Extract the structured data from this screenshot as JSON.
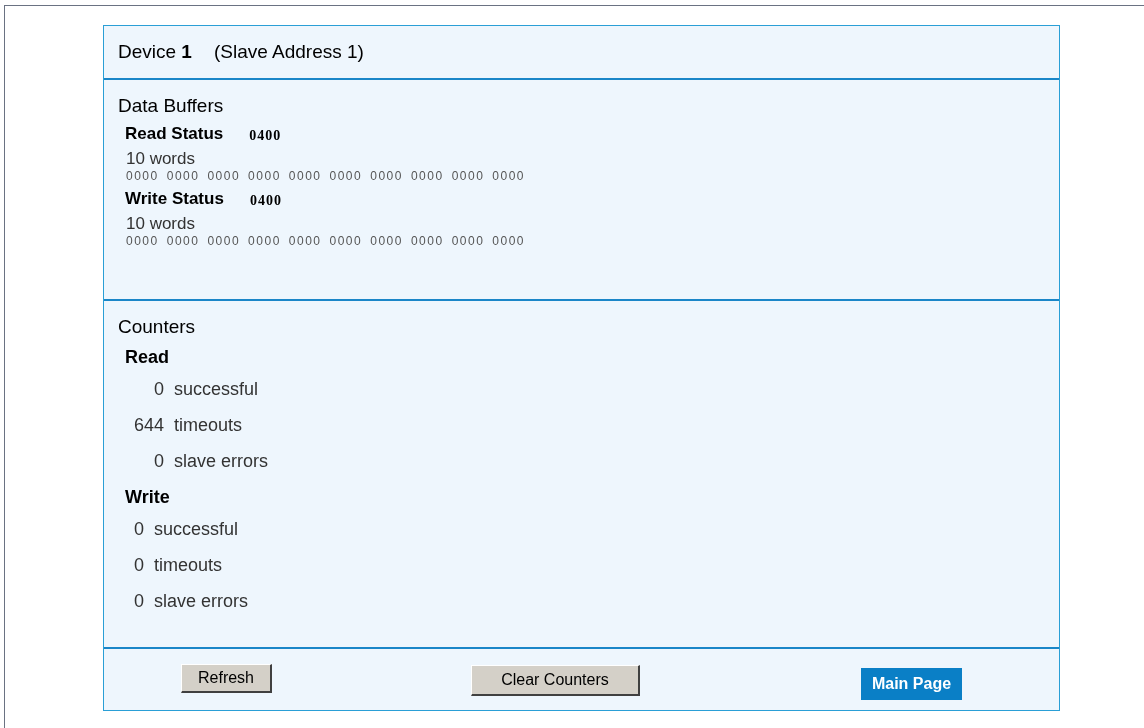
{
  "device": {
    "title": "Device **1**",
    "address": "(Slave Address 1)"
  },
  "data_buffers": {
    "heading": "Data Buffers",
    "groups": [
      {
        "label": "Read Status",
        "status": "0400",
        "count": "10 words",
        "words": [
          "0000",
          "0000",
          "0000",
          "0000",
          "0000",
          "0000",
          "0000",
          "0000",
          "0000",
          "0000"
        ]
      },
      {
        "label": "Write Status",
        "status": "0400",
        "count": "10 words",
        "words": [
          "0000",
          "0000",
          "0000",
          "0000",
          "0000",
          "0000",
          "0000",
          "0000",
          "0000",
          "0000"
        ]
      }
    ]
  },
  "counters": {
    "heading": "Counters",
    "groups": [
      {
        "label": "Read",
        "rows": [
          {
            "value": "0",
            "label": "successful"
          },
          {
            "value": "644",
            "label": "timeouts"
          },
          {
            "value": "0",
            "label": "slave errors"
          }
        ]
      },
      {
        "label": "Write",
        "rows": [
          {
            "value": "0",
            "label": "successful"
          },
          {
            "value": "0",
            "label": "timeouts"
          },
          {
            "value": "0",
            "label": "slave errors"
          }
        ]
      }
    ]
  },
  "buttons": [
    {
      "label": "Refresh",
      "kind": "gray"
    },
    {
      "label": "Clear Counters",
      "kind": "gray"
    },
    {
      "label": "Main Page",
      "kind": "link"
    }
  ]
}
